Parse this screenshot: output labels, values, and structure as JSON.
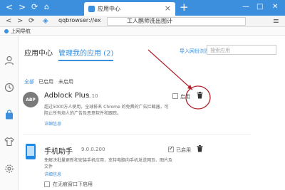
{
  "tabbar": {
    "tab_title": "应用中心",
    "new_tab_symbol": "+",
    "close_symbol": "×",
    "minimize_symbol": "—",
    "maximize_symbol": "□",
    "window_close_symbol": "✕"
  },
  "toolbar": {
    "url": "qqbrowser://ex",
    "url_title": "工人鹏师洗出图计"
  },
  "bookmarks": {
    "item_label": "上网导航"
  },
  "main": {
    "app_center_label": "应用中心",
    "my_apps_label": "管理我的应用 (2)",
    "import_label": "导入网份浏览器应用",
    "search_placeholder": "搜索应用",
    "filters": [
      "全部",
      "已启用",
      "未启用"
    ]
  },
  "extensions": [
    {
      "icon_text": "ABP",
      "name": "Adblock Plus",
      "version": "1.10",
      "description": "超过5000万人使用，全球排名 Chrome 的免费的广告拦截器，可阻止所有烦人的广告及恶意软件和跟踪。",
      "details_label": "详细信息",
      "enabled": false,
      "status_label": "启用"
    },
    {
      "icon_text": "",
      "name": "手机助手",
      "version": "9.0.0.200",
      "description": "免解决批量更新和安装手机应用，支持电脑向手机发送网页、图片及文件",
      "details_label": "详细信息",
      "enabled": true,
      "status_label": "已启用"
    }
  ],
  "incognito_label": "在无痕窗口下启用",
  "colors": {
    "accent": "#3c8fdc",
    "annotation": "#b1202a"
  }
}
